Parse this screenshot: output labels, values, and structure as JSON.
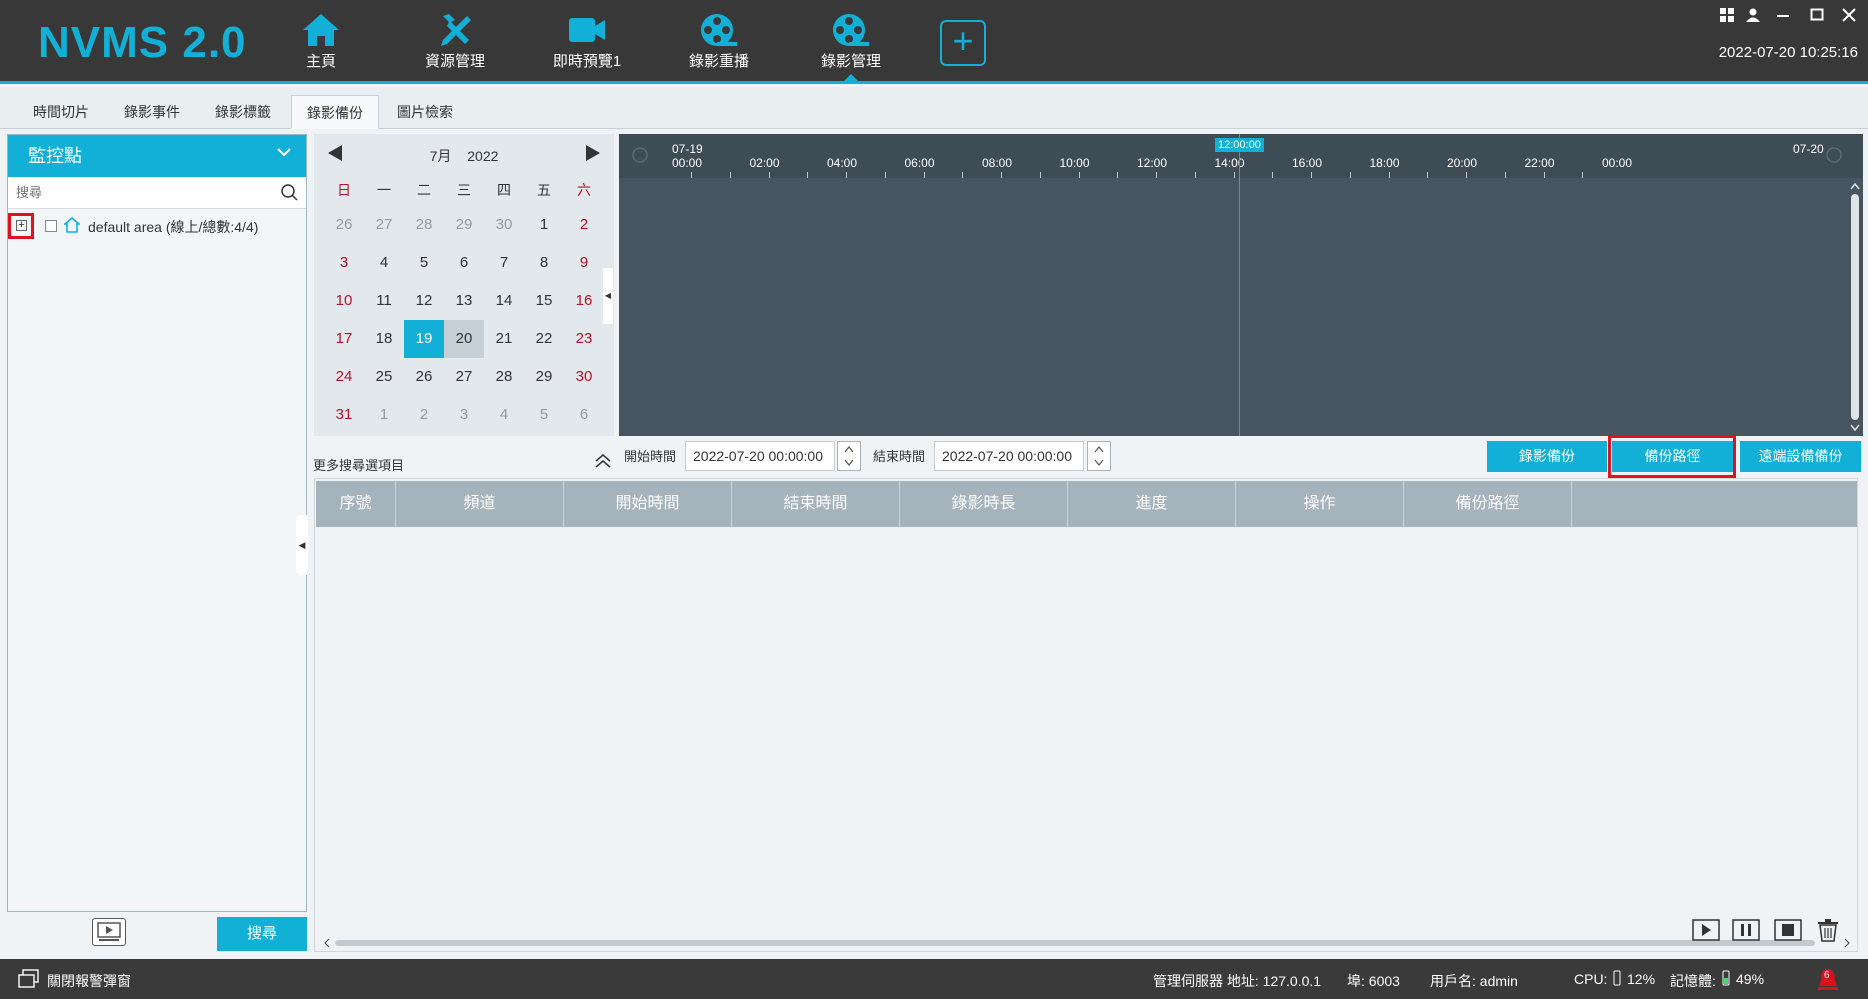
{
  "app": {
    "title": "NVMS 2.0",
    "datetime": "2022-07-20 10:25:16",
    "accent": "#12b0d6",
    "highlight": "#e0121f"
  },
  "nav": {
    "items": [
      {
        "label": "主頁",
        "icon": "home-icon"
      },
      {
        "label": "資源管理",
        "icon": "tools-icon"
      },
      {
        "label": "即時預覽1",
        "icon": "camera-icon"
      },
      {
        "label": "錄影重播",
        "icon": "film-reel-icon"
      },
      {
        "label": "錄影管理",
        "icon": "film-reel-icon",
        "active": true
      }
    ],
    "add_label": "+"
  },
  "tabs": [
    {
      "label": "時間切片"
    },
    {
      "label": "錄影事件"
    },
    {
      "label": "錄影標籤"
    },
    {
      "label": "錄影備份",
      "active": true
    },
    {
      "label": "圖片檢索"
    }
  ],
  "sidebar": {
    "title": "監控點",
    "search_placeholder": "搜尋",
    "tree": [
      {
        "label": "default area (線上/總數:4/4)"
      }
    ],
    "search_button": "搜尋",
    "collapse_arrow": "◀"
  },
  "calendar": {
    "month": "7月",
    "year": "2022",
    "weekdays": [
      "日",
      "一",
      "二",
      "三",
      "四",
      "五",
      "六"
    ],
    "weeks": [
      [
        "26",
        "27",
        "28",
        "29",
        "30",
        "1",
        "2"
      ],
      [
        "3",
        "4",
        "5",
        "6",
        "7",
        "8",
        "9"
      ],
      [
        "10",
        "11",
        "12",
        "13",
        "14",
        "15",
        "16"
      ],
      [
        "17",
        "18",
        "19",
        "20",
        "21",
        "22",
        "23"
      ],
      [
        "24",
        "25",
        "26",
        "27",
        "28",
        "29",
        "30"
      ],
      [
        "31",
        "1",
        "2",
        "3",
        "4",
        "5",
        "6"
      ]
    ],
    "selected_day": "19",
    "today_day": "20",
    "collapse_arrow": "◀"
  },
  "timeline": {
    "start_date": "07-19",
    "end_date": "07-20",
    "labels": [
      "00:00",
      "02:00",
      "04:00",
      "06:00",
      "08:00",
      "10:00",
      "12:00",
      "14:00",
      "16:00",
      "18:00",
      "20:00",
      "22:00",
      "00:00"
    ],
    "cursor_label": "12:00:00"
  },
  "options": {
    "more_label": "更多搜尋選項目",
    "start_label": "開始時間",
    "start_value": "2022-07-20 00:00:00",
    "end_label": "結束時間",
    "end_value": "2022-07-20 00:00:00",
    "buttons": [
      "錄影備份",
      "備份路徑",
      "遠端設備備份"
    ]
  },
  "table": {
    "columns": [
      "序號",
      "頻道",
      "開始時間",
      "結束時間",
      "錄影時長",
      "進度",
      "操作",
      "備份路徑"
    ],
    "rows": []
  },
  "statusbar": {
    "alarm_popup": "關閉報警彈窗",
    "server": "管理伺服器 地址: 127.0.0.1",
    "port": "埠: 6003",
    "user": "用戶名: admin",
    "cpu": "CPU:",
    "cpu_value": "12%",
    "memory": "記憶體:",
    "memory_value": "49%",
    "alarm_count": "6"
  }
}
